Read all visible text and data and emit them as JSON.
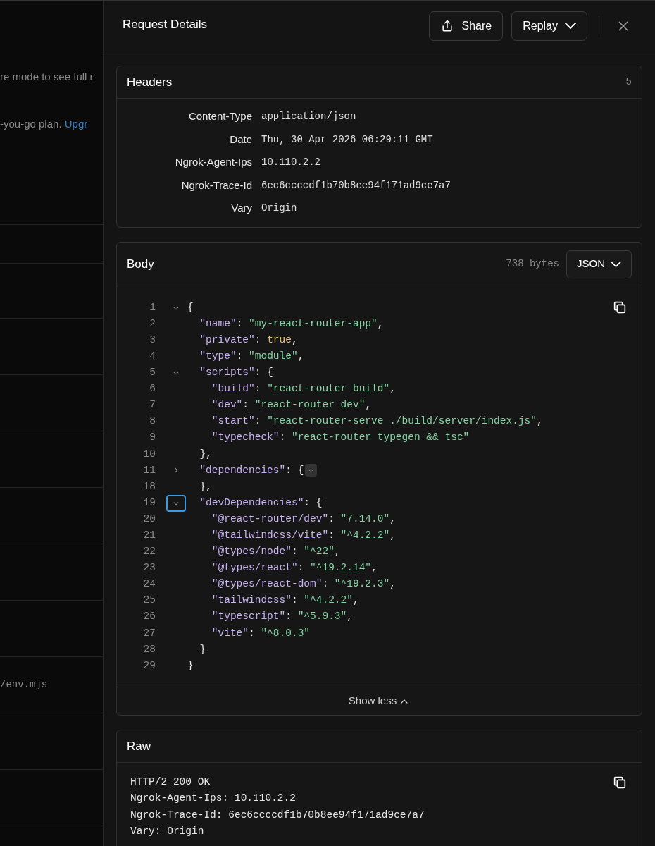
{
  "background_page": {
    "texts": [
      {
        "kind": "text",
        "text": "re mode to see full r"
      },
      {
        "kind": "plan",
        "text": "-you-go plan.",
        "link": "Upgr"
      },
      {
        "kind": "code",
        "text": "/env.mjs"
      }
    ]
  },
  "panel": {
    "title": "Request Details",
    "buttons": [
      {
        "kind": "share",
        "label": "Share"
      },
      {
        "kind": "replay",
        "label": "Replay"
      }
    ],
    "headers": {
      "title": "Headers",
      "count": "5",
      "rows": [
        {
          "name": "Content-Type",
          "value": "application/json"
        },
        {
          "name": "Date",
          "value": "Thu, 30 Apr 2026 06:29:11 GMT"
        },
        {
          "name": "Ngrok-Agent-Ips",
          "value": "10.110.2.2"
        },
        {
          "name": "Ngrok-Trace-Id",
          "value": "6ec6ccccdf1b70b8ee94f171ad9ce7a7"
        },
        {
          "name": "Vary",
          "value": "Origin"
        }
      ]
    },
    "body": {
      "title": "Body",
      "size": "738 bytes",
      "format": "JSON",
      "footer": "Show less",
      "lines": [
        {
          "n": "1",
          "toggle": {
            "expanded": true,
            "focused": false
          },
          "tokens": [
            {
              "kind": "punct",
              "text": "{"
            }
          ]
        },
        {
          "n": "2",
          "tokens": [
            {
              "kind": "key",
              "text": "  \"name\""
            },
            {
              "kind": "punct",
              "text": ": "
            },
            {
              "kind": "str",
              "text": "\"my-react-router-app\""
            },
            {
              "kind": "punct",
              "text": ","
            }
          ]
        },
        {
          "n": "3",
          "tokens": [
            {
              "kind": "key",
              "text": "  \"private\""
            },
            {
              "kind": "punct",
              "text": ": "
            },
            {
              "kind": "bool",
              "text": "true"
            },
            {
              "kind": "punct",
              "text": ","
            }
          ]
        },
        {
          "n": "4",
          "tokens": [
            {
              "kind": "key",
              "text": "  \"type\""
            },
            {
              "kind": "punct",
              "text": ": "
            },
            {
              "kind": "str",
              "text": "\"module\""
            },
            {
              "kind": "punct",
              "text": ","
            }
          ]
        },
        {
          "n": "5",
          "toggle": {
            "expanded": true,
            "focused": false
          },
          "tokens": [
            {
              "kind": "key",
              "text": "  \"scripts\""
            },
            {
              "kind": "punct",
              "text": ": {"
            }
          ]
        },
        {
          "n": "6",
          "tokens": [
            {
              "kind": "key",
              "text": "    \"build\""
            },
            {
              "kind": "punct",
              "text": ": "
            },
            {
              "kind": "str",
              "text": "\"react-router build\""
            },
            {
              "kind": "punct",
              "text": ","
            }
          ]
        },
        {
          "n": "7",
          "tokens": [
            {
              "kind": "key",
              "text": "    \"dev\""
            },
            {
              "kind": "punct",
              "text": ": "
            },
            {
              "kind": "str",
              "text": "\"react-router dev\""
            },
            {
              "kind": "punct",
              "text": ","
            }
          ]
        },
        {
          "n": "8",
          "tokens": [
            {
              "kind": "key",
              "text": "    \"start\""
            },
            {
              "kind": "punct",
              "text": ": "
            },
            {
              "kind": "str",
              "text": "\"react-router-serve ./build/server/index.js\""
            },
            {
              "kind": "punct",
              "text": ","
            }
          ]
        },
        {
          "n": "9",
          "tokens": [
            {
              "kind": "key",
              "text": "    \"typecheck\""
            },
            {
              "kind": "punct",
              "text": ": "
            },
            {
              "kind": "str",
              "text": "\"react-router typegen && tsc\""
            }
          ]
        },
        {
          "n": "10",
          "tokens": [
            {
              "kind": "punct",
              "text": "  },"
            }
          ]
        },
        {
          "n": "11",
          "toggle": {
            "expanded": false,
            "focused": false
          },
          "tokens": [
            {
              "kind": "key",
              "text": "  \"dependencies\""
            },
            {
              "kind": "punct",
              "text": ": {"
            },
            {
              "kind": "ellipsis",
              "text": "⋯"
            }
          ]
        },
        {
          "n": "18",
          "tokens": [
            {
              "kind": "punct",
              "text": "  },"
            }
          ]
        },
        {
          "n": "19",
          "toggle": {
            "expanded": true,
            "focused": true
          },
          "tokens": [
            {
              "kind": "key",
              "text": "  \"devDependencies\""
            },
            {
              "kind": "punct",
              "text": ": {"
            }
          ]
        },
        {
          "n": "20",
          "tokens": [
            {
              "kind": "key",
              "text": "    \"@react-router/dev\""
            },
            {
              "kind": "punct",
              "text": ": "
            },
            {
              "kind": "str",
              "text": "\"7.14.0\""
            },
            {
              "kind": "punct",
              "text": ","
            }
          ]
        },
        {
          "n": "21",
          "tokens": [
            {
              "kind": "key",
              "text": "    \"@tailwindcss/vite\""
            },
            {
              "kind": "punct",
              "text": ": "
            },
            {
              "kind": "str",
              "text": "\"^4.2.2\""
            },
            {
              "kind": "punct",
              "text": ","
            }
          ]
        },
        {
          "n": "22",
          "tokens": [
            {
              "kind": "key",
              "text": "    \"@types/node\""
            },
            {
              "kind": "punct",
              "text": ": "
            },
            {
              "kind": "str",
              "text": "\"^22\""
            },
            {
              "kind": "punct",
              "text": ","
            }
          ]
        },
        {
          "n": "23",
          "tokens": [
            {
              "kind": "key",
              "text": "    \"@types/react\""
            },
            {
              "kind": "punct",
              "text": ": "
            },
            {
              "kind": "str",
              "text": "\"^19.2.14\""
            },
            {
              "kind": "punct",
              "text": ","
            }
          ]
        },
        {
          "n": "24",
          "tokens": [
            {
              "kind": "key",
              "text": "    \"@types/react-dom\""
            },
            {
              "kind": "punct",
              "text": ": "
            },
            {
              "kind": "str",
              "text": "\"^19.2.3\""
            },
            {
              "kind": "punct",
              "text": ","
            }
          ]
        },
        {
          "n": "25",
          "tokens": [
            {
              "kind": "key",
              "text": "    \"tailwindcss\""
            },
            {
              "kind": "punct",
              "text": ": "
            },
            {
              "kind": "str",
              "text": "\"^4.2.2\""
            },
            {
              "kind": "punct",
              "text": ","
            }
          ]
        },
        {
          "n": "26",
          "tokens": [
            {
              "kind": "key",
              "text": "    \"typescript\""
            },
            {
              "kind": "punct",
              "text": ": "
            },
            {
              "kind": "str",
              "text": "\"^5.9.3\""
            },
            {
              "kind": "punct",
              "text": ","
            }
          ]
        },
        {
          "n": "27",
          "tokens": [
            {
              "kind": "key",
              "text": "    \"vite\""
            },
            {
              "kind": "punct",
              "text": ": "
            },
            {
              "kind": "str",
              "text": "\"^8.0.3\""
            }
          ]
        },
        {
          "n": "28",
          "tokens": [
            {
              "kind": "punct",
              "text": "  }"
            }
          ]
        },
        {
          "n": "29",
          "tokens": [
            {
              "kind": "punct",
              "text": "}"
            }
          ]
        }
      ]
    },
    "raw": {
      "title": "Raw",
      "lines": [
        "HTTP/2 200 OK",
        "Ngrok-Agent-Ips: 10.110.2.2",
        "Ngrok-Trace-Id: 6ec6ccccdf1b70b8ee94f171ad9ce7a7",
        "Vary: Origin"
      ]
    }
  }
}
